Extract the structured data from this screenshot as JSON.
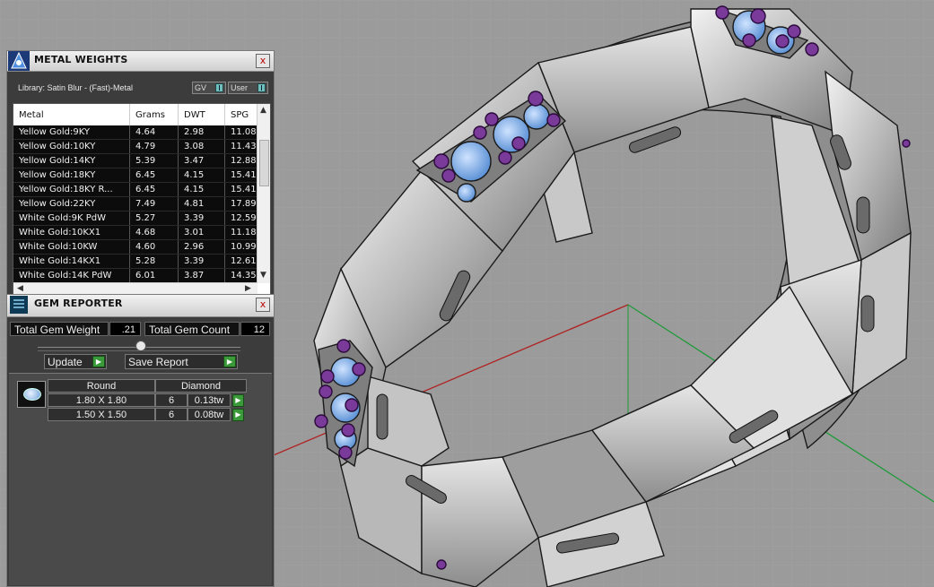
{
  "metal_weights": {
    "title": "METAL WEIGHTS",
    "close_label": "x",
    "library_label": "Library: Satin Blur - (Fast)-Metal",
    "toggles": [
      {
        "label": "GV"
      },
      {
        "label": "User"
      }
    ],
    "columns": [
      "Metal",
      "Grams",
      "DWT",
      "SPG"
    ],
    "rows": [
      {
        "metal": "Yellow Gold:9KY",
        "grams": "4.64",
        "dwt": "2.98",
        "spg": "11.08"
      },
      {
        "metal": "Yellow Gold:10KY",
        "grams": "4.79",
        "dwt": "3.08",
        "spg": "11.43"
      },
      {
        "metal": "Yellow Gold:14KY",
        "grams": "5.39",
        "dwt": "3.47",
        "spg": "12.88"
      },
      {
        "metal": "Yellow Gold:18KY",
        "grams": "6.45",
        "dwt": "4.15",
        "spg": "15.41"
      },
      {
        "metal": "Yellow Gold:18KY R...",
        "grams": "6.45",
        "dwt": "4.15",
        "spg": "15.41"
      },
      {
        "metal": "Yellow Gold:22KY",
        "grams": "7.49",
        "dwt": "4.81",
        "spg": "17.89"
      },
      {
        "metal": "White Gold:9K PdW",
        "grams": "5.27",
        "dwt": "3.39",
        "spg": "12.59"
      },
      {
        "metal": "White Gold:10KX1",
        "grams": "4.68",
        "dwt": "3.01",
        "spg": "11.18"
      },
      {
        "metal": "White Gold:10KW",
        "grams": "4.60",
        "dwt": "2.96",
        "spg": "10.99"
      },
      {
        "metal": "White Gold:14KX1",
        "grams": "5.28",
        "dwt": "3.39",
        "spg": "12.61"
      },
      {
        "metal": "White Gold:14K PdW",
        "grams": "6.01",
        "dwt": "3.87",
        "spg": "14.35"
      }
    ]
  },
  "gem_reporter": {
    "title": "GEM REPORTER",
    "close_label": "x",
    "total_weight_label": "Total Gem Weight",
    "total_weight_value": ".21",
    "total_count_label": "Total Gem Count",
    "total_count_value": "12",
    "update_label": "Update",
    "save_report_label": "Save Report",
    "gem_shape": "Round",
    "gem_type": "Diamond",
    "gem_rows": [
      {
        "size": "1.80 X 1.80",
        "count": "6",
        "weight": "0.13tw"
      },
      {
        "size": "1.50 X 1.50",
        "count": "6",
        "weight": "0.08tw"
      }
    ]
  }
}
